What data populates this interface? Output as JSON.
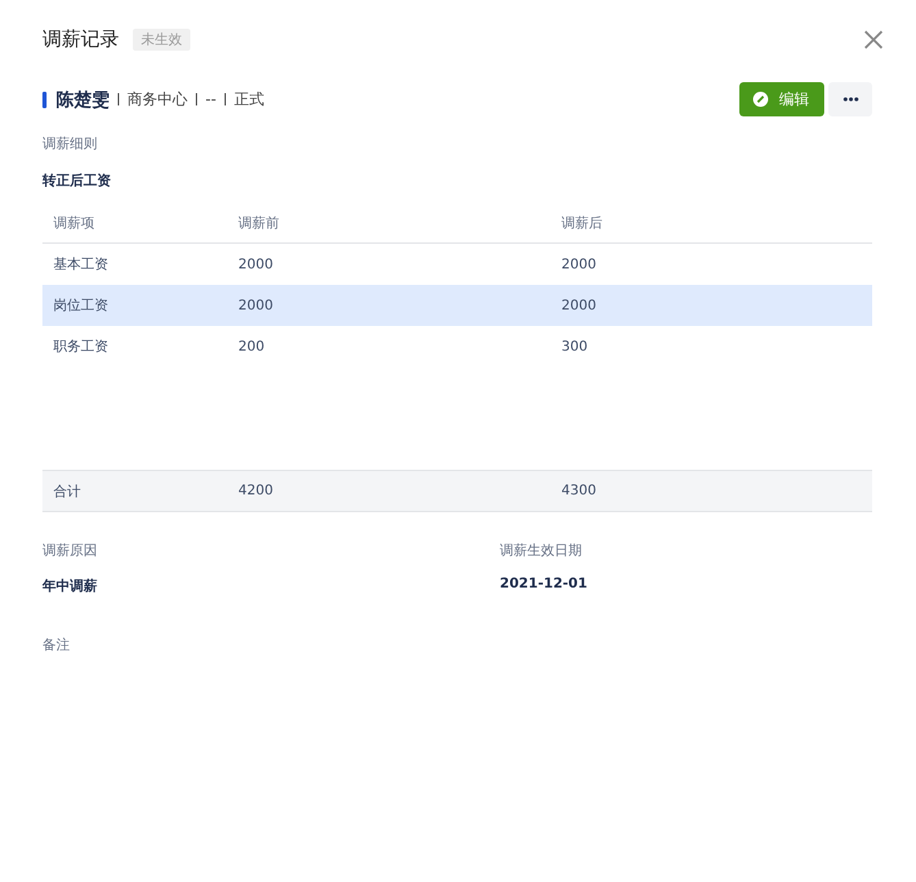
{
  "header": {
    "title": "调薪记录",
    "status": "未生效"
  },
  "employee": {
    "name": "陈楚雯",
    "details": [
      "商务中心",
      "--",
      "正式"
    ]
  },
  "actions": {
    "edit": "编辑"
  },
  "section_title": "调薪细则",
  "subsection_title": "转正后工资",
  "table": {
    "columns": [
      "调薪项",
      "调薪前",
      "调薪后"
    ],
    "rows": [
      {
        "cells": [
          "基本工资",
          "2000",
          "2000"
        ],
        "selected": false
      },
      {
        "cells": [
          "岗位工资",
          "2000",
          "2000"
        ],
        "selected": true
      },
      {
        "cells": [
          "职务工资",
          "200",
          "300"
        ],
        "selected": false
      }
    ],
    "total": [
      "合计",
      "4200",
      "4300"
    ]
  },
  "fields": [
    {
      "label": "调薪原因",
      "value": "年中调薪"
    },
    {
      "label": "调薪生效日期",
      "value": "2021-12-01"
    }
  ],
  "remark": {
    "label": "备注"
  }
}
